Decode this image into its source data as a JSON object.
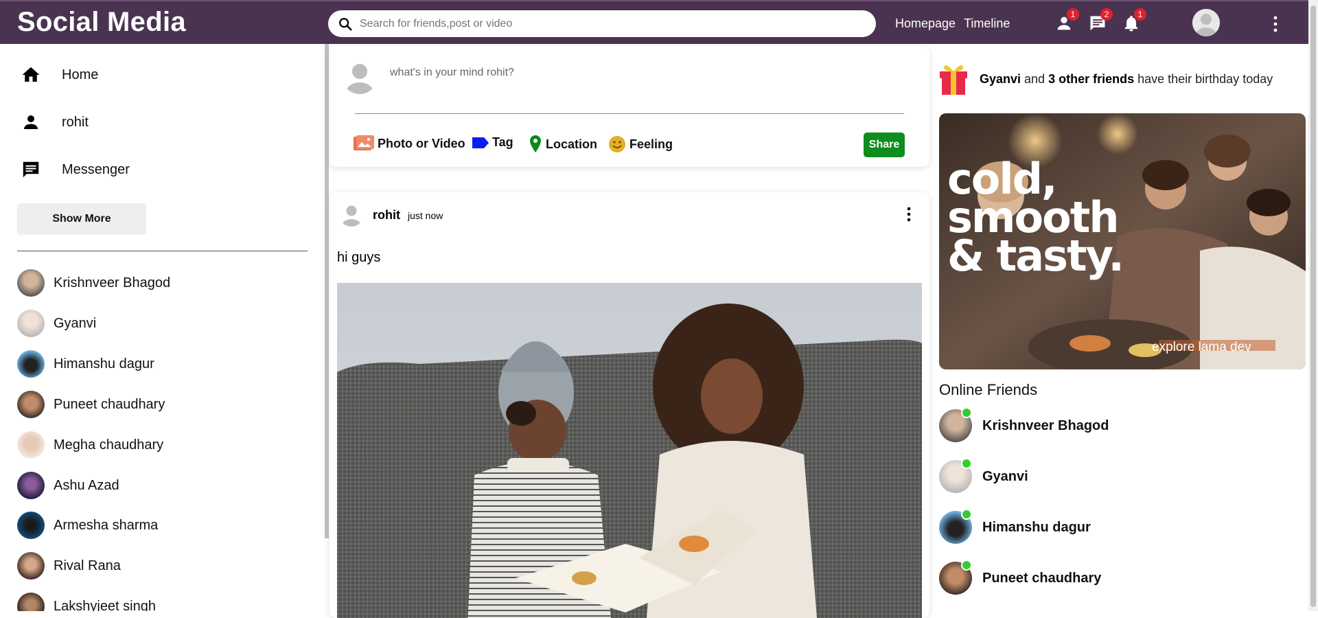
{
  "header": {
    "logo": "Social Media",
    "search_placeholder": "Search for friends,post or video",
    "links": [
      "Homepage",
      "Timeline"
    ],
    "badges": {
      "friends": "1",
      "messages": "2",
      "notifications": "1"
    }
  },
  "sidebar": {
    "items": [
      {
        "label": "Home",
        "icon": "home-icon"
      },
      {
        "label": "rohit",
        "icon": "person-icon"
      },
      {
        "label": "Messenger",
        "icon": "chat-icon"
      }
    ],
    "show_more": "Show More",
    "friends": [
      "Krishnveer Bhagod",
      "Gyanvi",
      "Himanshu dagur",
      "Puneet chaudhary",
      "Megha chaudhary",
      "Ashu Azad",
      "Armesha sharma",
      "Rival Rana",
      "Lakshyjeet singh"
    ]
  },
  "share": {
    "placeholder": "what's in your mind rohit?",
    "options": [
      "Photo or Video",
      "Tag",
      "Location",
      "Feeling"
    ],
    "button": "Share"
  },
  "post": {
    "user": "rohit",
    "time": "just now",
    "text": "hi guys"
  },
  "right": {
    "birthday_name": "Gyanvi",
    "birthday_and": " and ",
    "birthday_count": "3 other friends",
    "birthday_rest": " have their birthday today",
    "ad_lines": [
      "cold,",
      "smooth",
      "& tasty."
    ],
    "ad_caption": "explore lama dev",
    "online_title": "Online Friends",
    "online": [
      "Krishnveer Bhagod",
      "Gyanvi",
      "Himanshu dagur",
      "Puneet chaudhary"
    ]
  },
  "colors": {
    "topbar": "#4a3350",
    "share_button": "#0f8c1e",
    "online_dot": "#32cd32",
    "badge": "#e0202e"
  }
}
